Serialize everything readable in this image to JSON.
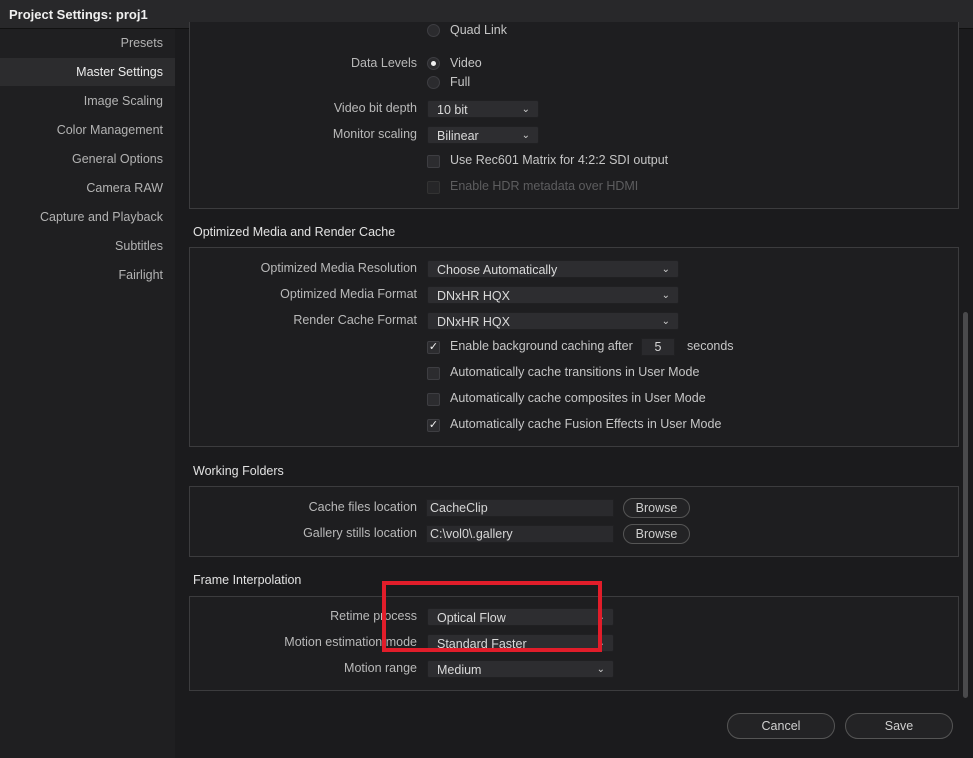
{
  "window": {
    "title": "Project Settings:  proj1"
  },
  "sidebar": {
    "items": [
      {
        "label": "Presets"
      },
      {
        "label": "Master Settings"
      },
      {
        "label": "Image Scaling"
      },
      {
        "label": "Color Management"
      },
      {
        "label": "General Options"
      },
      {
        "label": "Camera RAW"
      },
      {
        "label": "Capture and Playback"
      },
      {
        "label": "Subtitles"
      },
      {
        "label": "Fairlight"
      }
    ],
    "active": "Master Settings"
  },
  "video": {
    "quad_link_label": "Quad Link",
    "data_levels_label": "Data Levels",
    "data_levels_options": [
      "Video",
      "Full"
    ],
    "data_levels_selected": "Video",
    "bit_depth_label": "Video bit depth",
    "bit_depth_value": "10 bit",
    "monitor_scaling_label": "Monitor scaling",
    "monitor_scaling_value": "Bilinear",
    "rec601_label": "Use Rec601 Matrix for 4:2:2 SDI output",
    "rec601_checked": false,
    "hdr_label": "Enable HDR metadata over HDMI",
    "hdr_checked": false
  },
  "optimized": {
    "title": "Optimized Media and Render Cache",
    "resolution_label": "Optimized Media Resolution",
    "resolution_value": "Choose Automatically",
    "format_label": "Optimized Media Format",
    "format_value": "DNxHR HQX",
    "render_format_label": "Render Cache Format",
    "render_format_value": "DNxHR HQX",
    "bg_caching_label": "Enable background caching after",
    "bg_caching_value": "5",
    "bg_caching_unit": "seconds",
    "bg_caching_checked": true,
    "transitions_label": "Automatically cache transitions in User Mode",
    "transitions_checked": false,
    "composites_label": "Automatically cache composites in User Mode",
    "composites_checked": false,
    "fusion_label": "Automatically cache Fusion Effects in User Mode",
    "fusion_checked": true
  },
  "folders": {
    "title": "Working Folders",
    "cache_label": "Cache files location",
    "cache_value": "CacheClip",
    "gallery_label": "Gallery stills location",
    "gallery_value": "C:\\vol0\\.gallery",
    "browse_label": "Browse"
  },
  "interp": {
    "title": "Frame Interpolation",
    "retime_label": "Retime process",
    "retime_value": "Optical Flow",
    "motion_mode_label": "Motion estimation mode",
    "motion_mode_value": "Standard Faster",
    "motion_range_label": "Motion range",
    "motion_range_value": "Medium"
  },
  "footer": {
    "cancel_label": "Cancel",
    "save_label": "Save"
  },
  "colors": {
    "highlight": "#e11d2a",
    "background": "#1b1b1d"
  }
}
